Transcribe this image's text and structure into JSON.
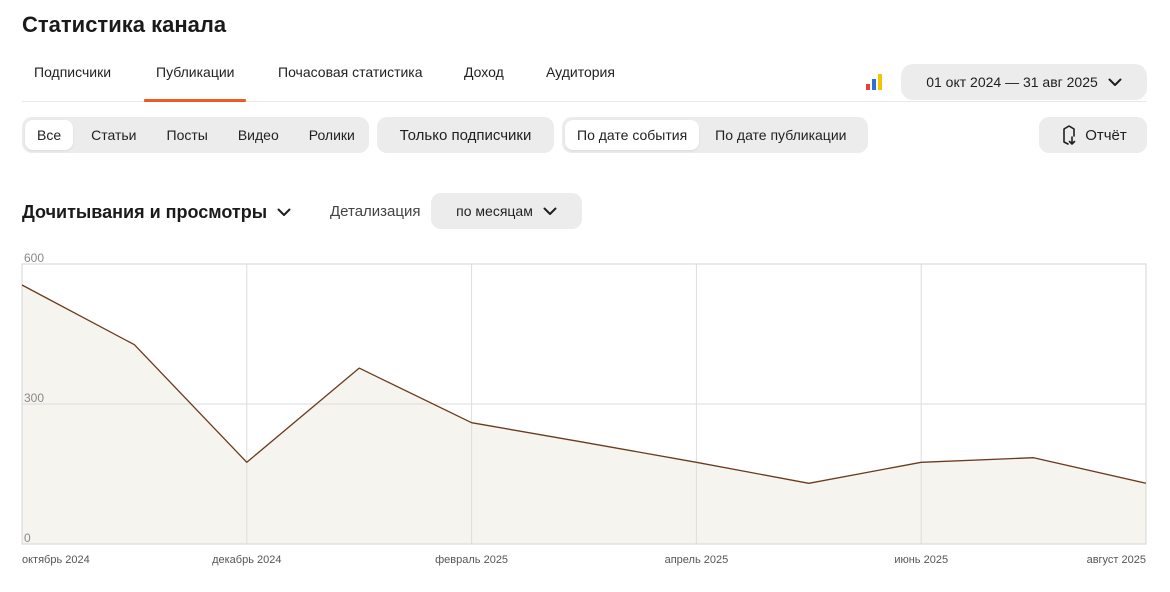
{
  "page_title": "Статистика канала",
  "tabs": [
    {
      "label": "Подписчики",
      "active": false
    },
    {
      "label": "Публикации",
      "active": true
    },
    {
      "label": "Почасовая статистика",
      "active": false
    },
    {
      "label": "Доход",
      "active": false
    },
    {
      "label": "Аудитория",
      "active": false
    }
  ],
  "date_range": "01 окт 2024 — 31 авг 2025",
  "type_filter": {
    "items": [
      "Все",
      "Статьи",
      "Посты",
      "Видео",
      "Ролики"
    ],
    "selected": "Все"
  },
  "subscribers_only": "Только подписчики",
  "date_mode": {
    "items": [
      "По дате события",
      "По дате публикации"
    ],
    "selected": "По дате события"
  },
  "report_button": "Отчёт",
  "metric_title": "Дочитывания и просмотры",
  "detail": {
    "label": "Детализация",
    "value": "по месяцам"
  },
  "colors": {
    "accent": "#ef5a22",
    "line": "#6b3a1e",
    "area": "#f5f4ef",
    "grid": "#dddddd",
    "pill": "#ececec"
  },
  "chart_data": {
    "type": "area",
    "x": [
      "2024-10",
      "2024-11",
      "2024-12",
      "2025-01",
      "2025-02",
      "2025-03",
      "2025-04",
      "2025-05",
      "2025-06",
      "2025-07",
      "2025-08"
    ],
    "x_tick_labels": [
      {
        "x": "2024-10",
        "label": "октябрь 2024"
      },
      {
        "x": "2024-12",
        "label": "декабрь 2024"
      },
      {
        "x": "2025-02",
        "label": "февраль 2025"
      },
      {
        "x": "2025-04",
        "label": "апрель 2025"
      },
      {
        "x": "2025-06",
        "label": "июнь 2025"
      },
      {
        "x": "2025-08",
        "label": "август 2025"
      }
    ],
    "y_ticks": [
      0,
      300,
      600
    ],
    "ylim": [
      0,
      600
    ],
    "series": [
      {
        "values": [
          555,
          427,
          175,
          377,
          260,
          218,
          175,
          130,
          175,
          185,
          130
        ]
      }
    ],
    "grid": true
  }
}
